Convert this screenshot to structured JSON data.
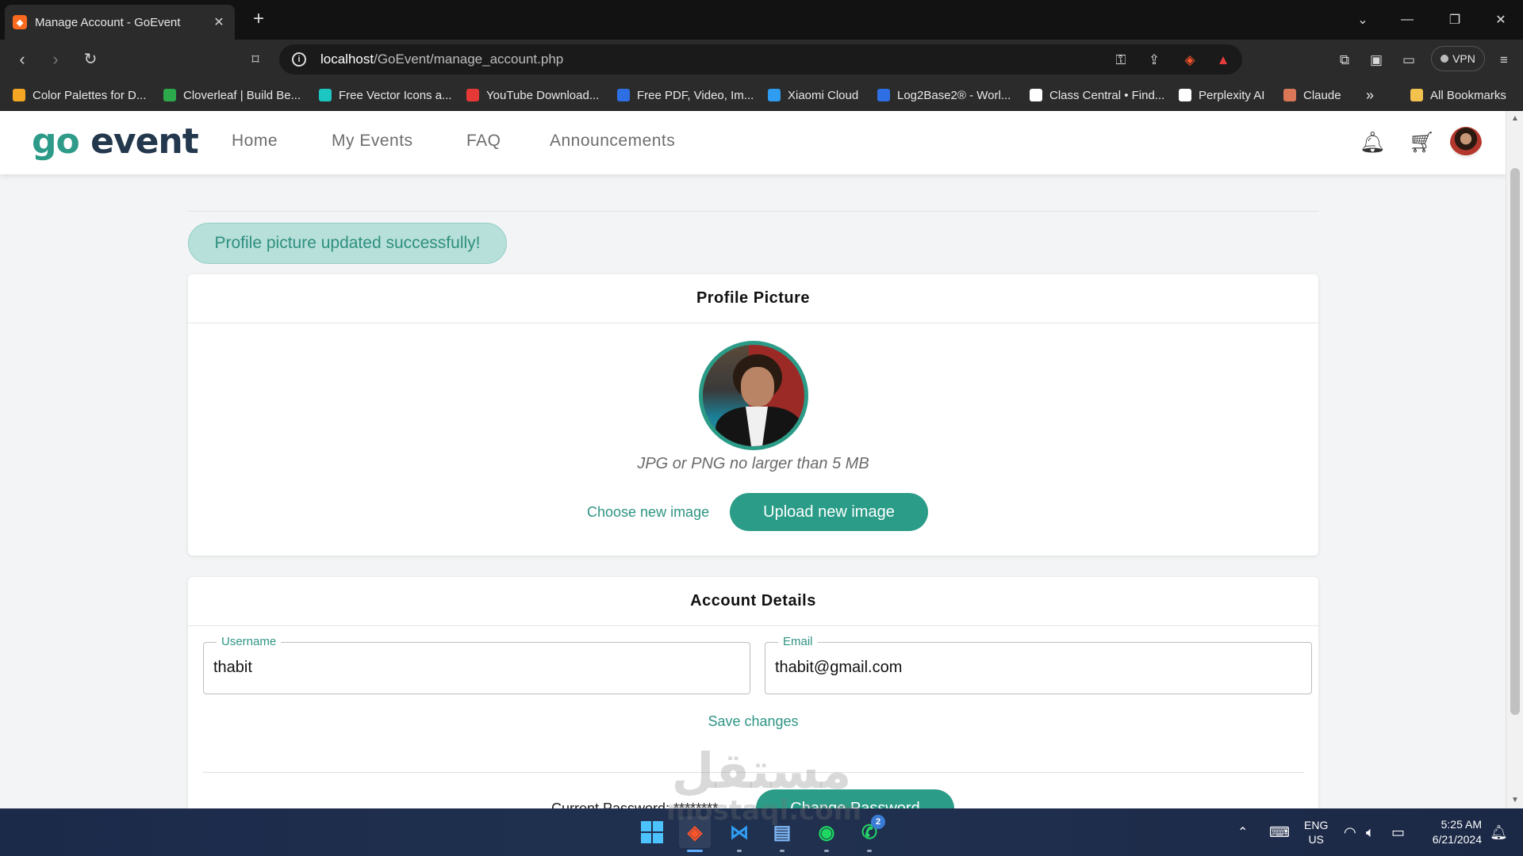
{
  "browser": {
    "tab_title": "Manage Account - GoEvent",
    "tab_close": "✕",
    "new_tab": "+",
    "url_host": "localhost",
    "url_path": "/GoEvent/manage_account.php",
    "vpn_label": "VPN",
    "bookmarks": [
      {
        "label": "Color Palettes for D...",
        "color": "#f5a623"
      },
      {
        "label": "Cloverleaf | Build Be...",
        "color": "#2ca94b"
      },
      {
        "label": "Free Vector Icons a...",
        "color": "#1cc6c1"
      },
      {
        "label": "YouTube Download...",
        "color": "#e53935"
      },
      {
        "label": "Free PDF, Video, Im...",
        "color": "#2f6fe4"
      },
      {
        "label": "Xiaomi Cloud",
        "color": "#2e9cf0"
      },
      {
        "label": "Log2Base2® - Worl...",
        "color": "#2f6fe4"
      },
      {
        "label": "Class Central • Find...",
        "color": "#ffffff"
      },
      {
        "label": "Perplexity AI",
        "color": "#ffffff"
      },
      {
        "label": "Claude",
        "color": "#d97757"
      }
    ],
    "more_bookmarks": "»",
    "all_bookmarks": "All Bookmarks"
  },
  "site": {
    "logo_go": "go",
    "logo_event": "event",
    "nav": [
      "Home",
      "My Events",
      "FAQ",
      "Announcements"
    ]
  },
  "alert": "Profile picture updated successfully!",
  "profile_card": {
    "title": "Profile Picture",
    "hint": "JPG or PNG no larger than 5 MB",
    "choose_label": "Choose new image",
    "upload_label": "Upload new image"
  },
  "account_card": {
    "title": "Account Details",
    "username_label": "Username",
    "username_value": "thabit",
    "email_label": "Email",
    "email_value": "thabit@gmail.com",
    "save_label": "Save changes",
    "password_label": "Current Password: ********",
    "change_password_label": "Change Password"
  },
  "watermark": {
    "arabic": "مستقل",
    "latin": "mostaql.com"
  },
  "taskbar": {
    "lang_top": "ENG",
    "lang_bottom": "US",
    "time": "5:25 AM",
    "date": "6/21/2024",
    "whatsapp_badge": "2"
  },
  "colors": {
    "accent": "#2a9c87",
    "logo_dark": "#23374d",
    "alert_bg": "#b7e0da"
  }
}
